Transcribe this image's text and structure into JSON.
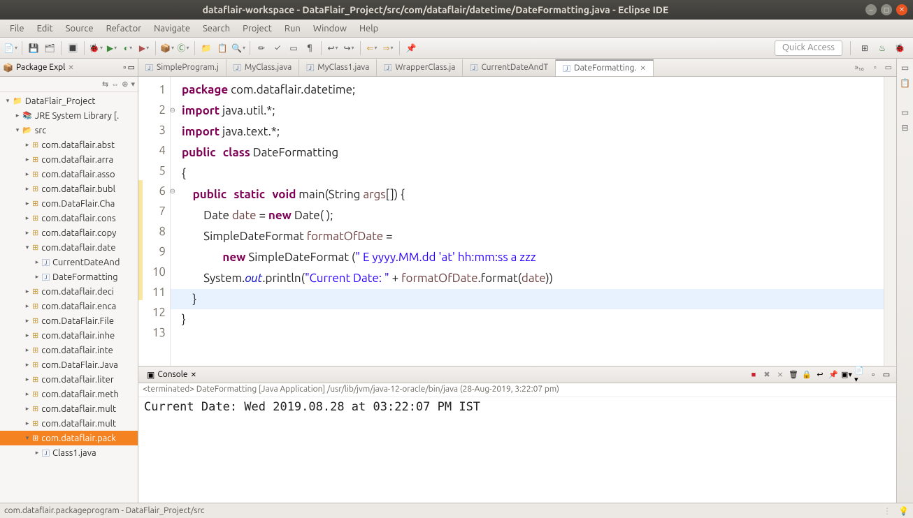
{
  "window": {
    "title": "dataflair-workspace - DataFlair_Project/src/com/dataflair/datetime/DateFormatting.java - Eclipse IDE"
  },
  "menu": [
    "File",
    "Edit",
    "Source",
    "Refactor",
    "Navigate",
    "Search",
    "Project",
    "Run",
    "Window",
    "Help"
  ],
  "quick_access_placeholder": "Quick Access",
  "package_explorer": {
    "title": "Package Expl",
    "project": "DataFlair_Project",
    "jre": "JRE System Library [.",
    "src": "src",
    "packages": [
      "com.dataflair.abst",
      "com.dataflair.arra",
      "com.dataflair.asso",
      "com.dataflair.bubl",
      "com.DataFlair.Cha",
      "com.dataflair.cons",
      "com.dataflair.copy",
      "com.dataflair.date"
    ],
    "date_children": [
      "CurrentDateAnd",
      "DateFormatting"
    ],
    "packages_after": [
      "com.dataflair.deci",
      "com.dataflair.enca",
      "com.DataFlair.File",
      "com.dataflair.inhe",
      "com.dataflair.inte",
      "com.DataFlair.Java",
      "com.dataflair.liter",
      "com.dataflair.meth",
      "com.dataflair.mult",
      "com.dataflair.mult"
    ],
    "selected_pkg": "com.dataflair.pack",
    "selected_child": "Class1.java"
  },
  "editor_tabs": {
    "tabs": [
      "SimpleProgram.j",
      "MyClass.java",
      "MyClass1.java",
      "WrapperClass.ja",
      "CurrentDateAndT",
      "DateFormatting."
    ],
    "active_index": 5,
    "more": "»₁₀"
  },
  "code": {
    "lines": [
      "1",
      "2",
      "3",
      "4",
      "5",
      "6",
      "7",
      "8",
      "9",
      "10",
      "11",
      "12",
      "13"
    ],
    "l1_kw": "package",
    "l1_rest": " com.dataflair.datetime;",
    "l2_kw": "import",
    "l2_rest": " java.util.*;",
    "l3_kw": "import",
    "l3_rest": " java.text.*;",
    "l4_kw1": "public",
    "l4_kw2": "class",
    "l4_rest": " DateFormatting",
    "l5": "{",
    "l6_indent": "    ",
    "l6_kw1": "public",
    "l6_kw2": "static",
    "l6_kw3": "void",
    "l6_m": " main(String ",
    "l6_arg": "args",
    "l6_end": "[]) {",
    "l7_indent": "        ",
    "l7_t": "Date ",
    "l7_v": "date",
    "l7_eq": " = ",
    "l7_kw": "new",
    "l7_end": " Date( );",
    "l8_indent": "        ",
    "l8_t": "SimpleDateFormat ",
    "l8_v": "formatOfDate",
    "l8_end": " =",
    "l9_indent": "               ",
    "l9_kw": "new",
    "l9_mid": " SimpleDateFormat (",
    "l9_str": "\" E yyyy.MM.dd 'at' hh:mm:ss a zzz",
    "l10_indent": "        ",
    "l10_a": "System.",
    "l10_out": "out",
    "l10_b": ".println(",
    "l10_str": "\"Current Date: \"",
    "l10_c": " + ",
    "l10_v": "formatOfDate",
    "l10_d": ".format(",
    "l10_v2": "date",
    "l10_e": "))",
    "l11_indent": "    ",
    "l11": "}",
    "l12": "}",
    "l13": ""
  },
  "console": {
    "title": "Console",
    "status": "<terminated> DateFormatting [Java Application] /usr/lib/jvm/java-12-oracle/bin/java (28-Aug-2019, 3:22:07 pm)",
    "output": "Current Date:  Wed 2019.08.28 at 03:22:07 PM IST"
  },
  "statusbar": {
    "left": "com.dataflair.packageprogram - DataFlair_Project/src"
  }
}
